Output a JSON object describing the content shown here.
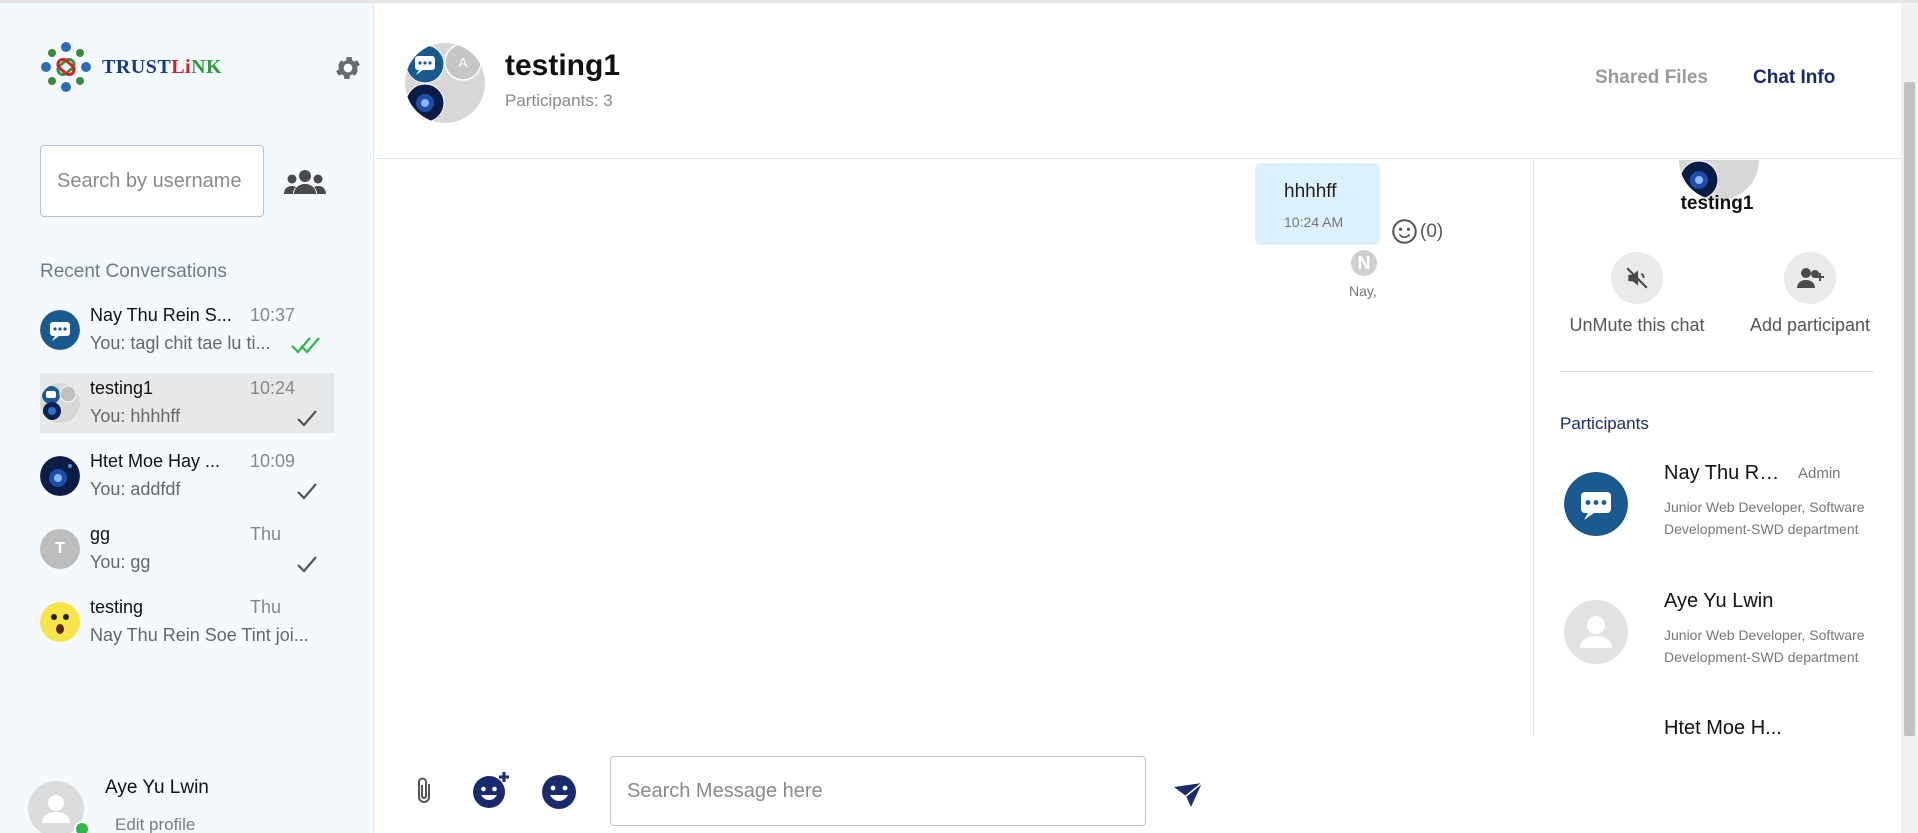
{
  "brand": {
    "logo_text_1": "TRUST",
    "logo_text_2": "Li",
    "logo_text_3": "NK"
  },
  "sidebar": {
    "search_placeholder": "Search by username",
    "recent_title": "Recent Conversations",
    "conversations": [
      {
        "name": "Nay Thu Rein S...",
        "time": "10:37",
        "last": "You: tagl chit tae lu ti...",
        "status": "read",
        "avatar": "chat-bubble"
      },
      {
        "name": "testing1",
        "time": "10:24",
        "last": "You: hhhhff",
        "status": "sent",
        "avatar": "group"
      },
      {
        "name": "Htet Moe Hay ...",
        "time": "10:09",
        "last": "You: addfdf",
        "status": "sent",
        "avatar": "photo"
      },
      {
        "name": "gg",
        "time": "Thu",
        "last": "You: gg",
        "status": "sent",
        "avatar": "letter",
        "avatar_letter": "T"
      },
      {
        "name": "testing",
        "time": "Thu",
        "last": "Nay Thu Rein Soe Tint joi...",
        "status": "none",
        "avatar": "emoji"
      }
    ],
    "me": {
      "name": "Aye Yu Lwin",
      "edit_label": "Edit profile"
    }
  },
  "header": {
    "title": "testing1",
    "participants_label": "Participants: 3",
    "tabs": [
      {
        "label": "Shared Files"
      },
      {
        "label": "Chat Info"
      }
    ],
    "group_avatar_letter": "A"
  },
  "chat": {
    "messages": [
      {
        "text": "hhhhff",
        "time": "10:24 AM",
        "reactions": "(0)",
        "seen_by_initial": "N",
        "seen_by": "Nay,"
      }
    ]
  },
  "info_panel": {
    "name": "testing1",
    "actions": [
      {
        "label": "UnMute this chat"
      },
      {
        "label": "Add participant"
      }
    ],
    "participants_title": "Participants",
    "participants": [
      {
        "name": "Nay Thu Rei...",
        "role": "Admin",
        "desc": "Junior Web Developer, Software Development-SWD department"
      },
      {
        "name": "Aye Yu Lwin",
        "role": "",
        "desc": "Junior Web Developer, Software Development-SWD department"
      },
      {
        "name": "Htet Moe H...",
        "role": "",
        "desc": ""
      }
    ]
  },
  "composer": {
    "placeholder": "Search Message here"
  },
  "colors": {
    "accent": "#1a2a6c",
    "avatar_blue": "#1b5a8f",
    "read_tick": "#2bb74a",
    "bubble": "#dcf0fd",
    "sidebar_bg": "#f4f9fd"
  }
}
